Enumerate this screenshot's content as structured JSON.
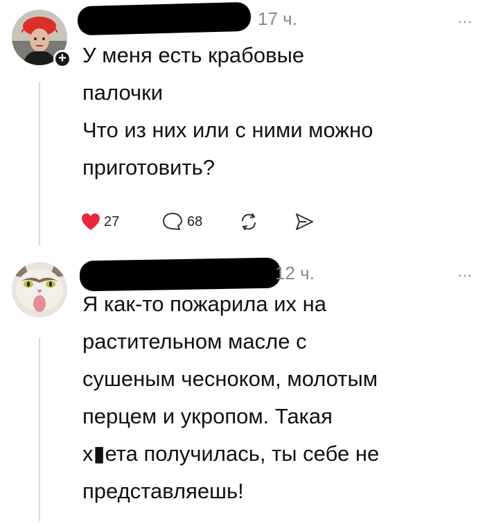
{
  "posts": [
    {
      "time": "17 ч.",
      "more": "...",
      "text_lines": [
        "У меня есть крабовые",
        "палочки",
        "Что из них или с ними можно",
        "приготовить?"
      ],
      "likes": "27",
      "comments": "68",
      "icons": [
        "heart-icon",
        "comment-icon",
        "repost-icon",
        "share-icon"
      ],
      "like_color": "#e8273f"
    },
    {
      "time": "12 ч.",
      "more": "...",
      "text_lines": [
        "Я как-то пожарила их на",
        "растительном масле с",
        "сушеным чесноком, молотым",
        "перцем и укропом. Такая",
        "х▮ета получилась, ты себе не",
        "представляешь!"
      ]
    }
  ]
}
